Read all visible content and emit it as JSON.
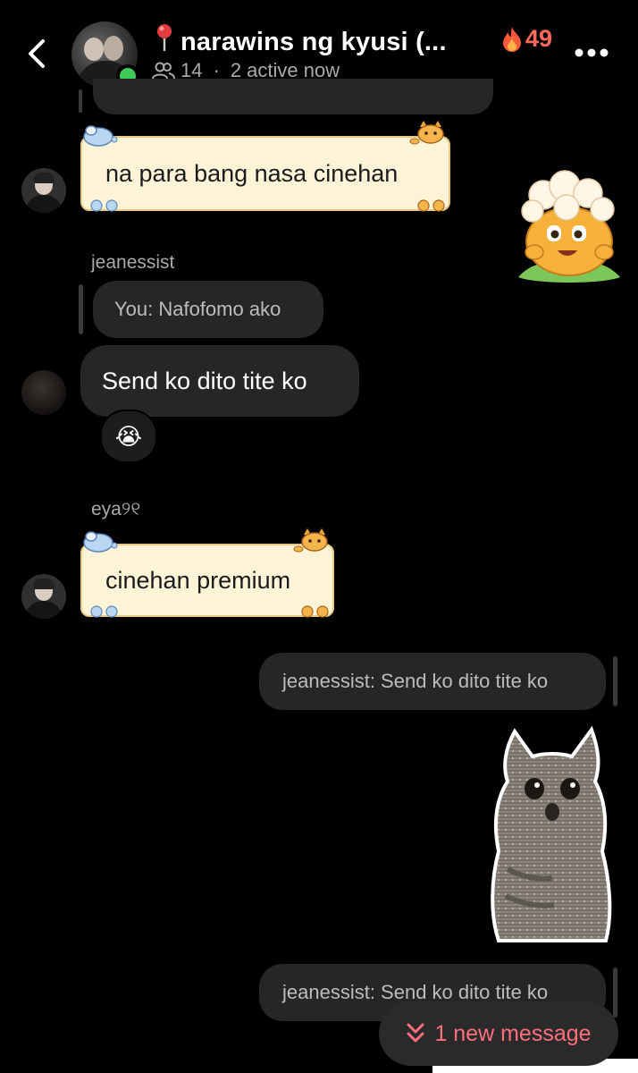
{
  "header": {
    "title": "narawins ng kyusi (...",
    "member_count": "14",
    "active_status": "2 active now",
    "streak_count": "49"
  },
  "messages": {
    "m1_text": "na para bang nasa cinehan",
    "m2_sender": "jeanessist",
    "m2_reply_preview": "You: Nafofomo ako",
    "m2_text": "Send ko dito tite ko",
    "m2_reaction": "😭",
    "m3_sender": "eya୨୧",
    "m3_text": "cinehan premium",
    "m4_reply_preview": "jeanessist: Send ko dito tite ko",
    "m5_reply_preview": "jeanessist: Send ko dito tite ko"
  },
  "new_message_pill": {
    "label": "1 new message"
  },
  "colors": {
    "background": "#000000",
    "bubble_dark": "#262626",
    "themed_bubble": "#fdf4d8",
    "online_green": "#3ecb5a",
    "accent_pink": "#ff6f7d",
    "streak_red": "#ff6a5a"
  },
  "icons": [
    "back-chevron-icon",
    "pin-icon",
    "members-icon",
    "fire-icon",
    "more-options-icon",
    "double-chevron-down-icon"
  ]
}
